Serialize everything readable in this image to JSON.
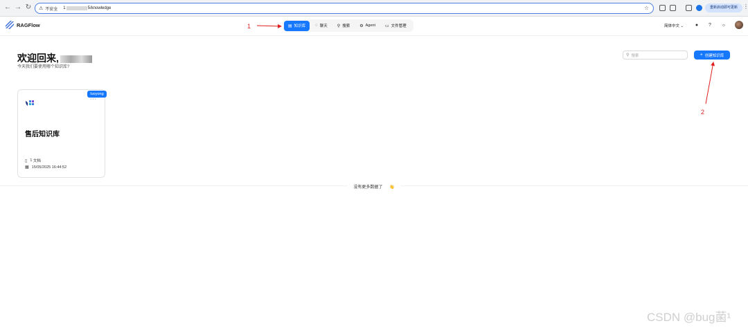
{
  "browser": {
    "insecure_label": "不安全",
    "url_host": "1",
    "url_path": "5/knowledge",
    "update_label": "重新启动即可更新",
    "kebab": "⋮"
  },
  "app": {
    "brand": "RAGFlow",
    "tabs": [
      {
        "label": "知识库",
        "icon": "database-icon",
        "active": true
      },
      {
        "label": "聊天",
        "icon": "chat-icon",
        "active": false
      },
      {
        "label": "搜索",
        "icon": "search-icon",
        "active": false
      },
      {
        "label": "Agent",
        "icon": "agent-icon",
        "active": false
      },
      {
        "label": "文件管理",
        "icon": "folder-icon",
        "active": false
      }
    ],
    "language": "简体中文",
    "accent_color": "#1677ff"
  },
  "main": {
    "welcome": "欢迎回来,",
    "subtitle": "今天我们要使用哪个知识库?",
    "search_placeholder": "搜索",
    "create_label": "创建知识库"
  },
  "cards": [
    {
      "owner": "luoyong",
      "name": "售后知识库",
      "doc_count": "1",
      "doc_unit": "文档",
      "updated": "15/05/2025 16:44:52"
    }
  ],
  "footer": {
    "no_more": "没有更多数据了",
    "emoji": "👋"
  },
  "annotations": {
    "num1": "1",
    "num2": "2",
    "color": "#e02020"
  },
  "watermark": "CSDN @bug菌¹"
}
